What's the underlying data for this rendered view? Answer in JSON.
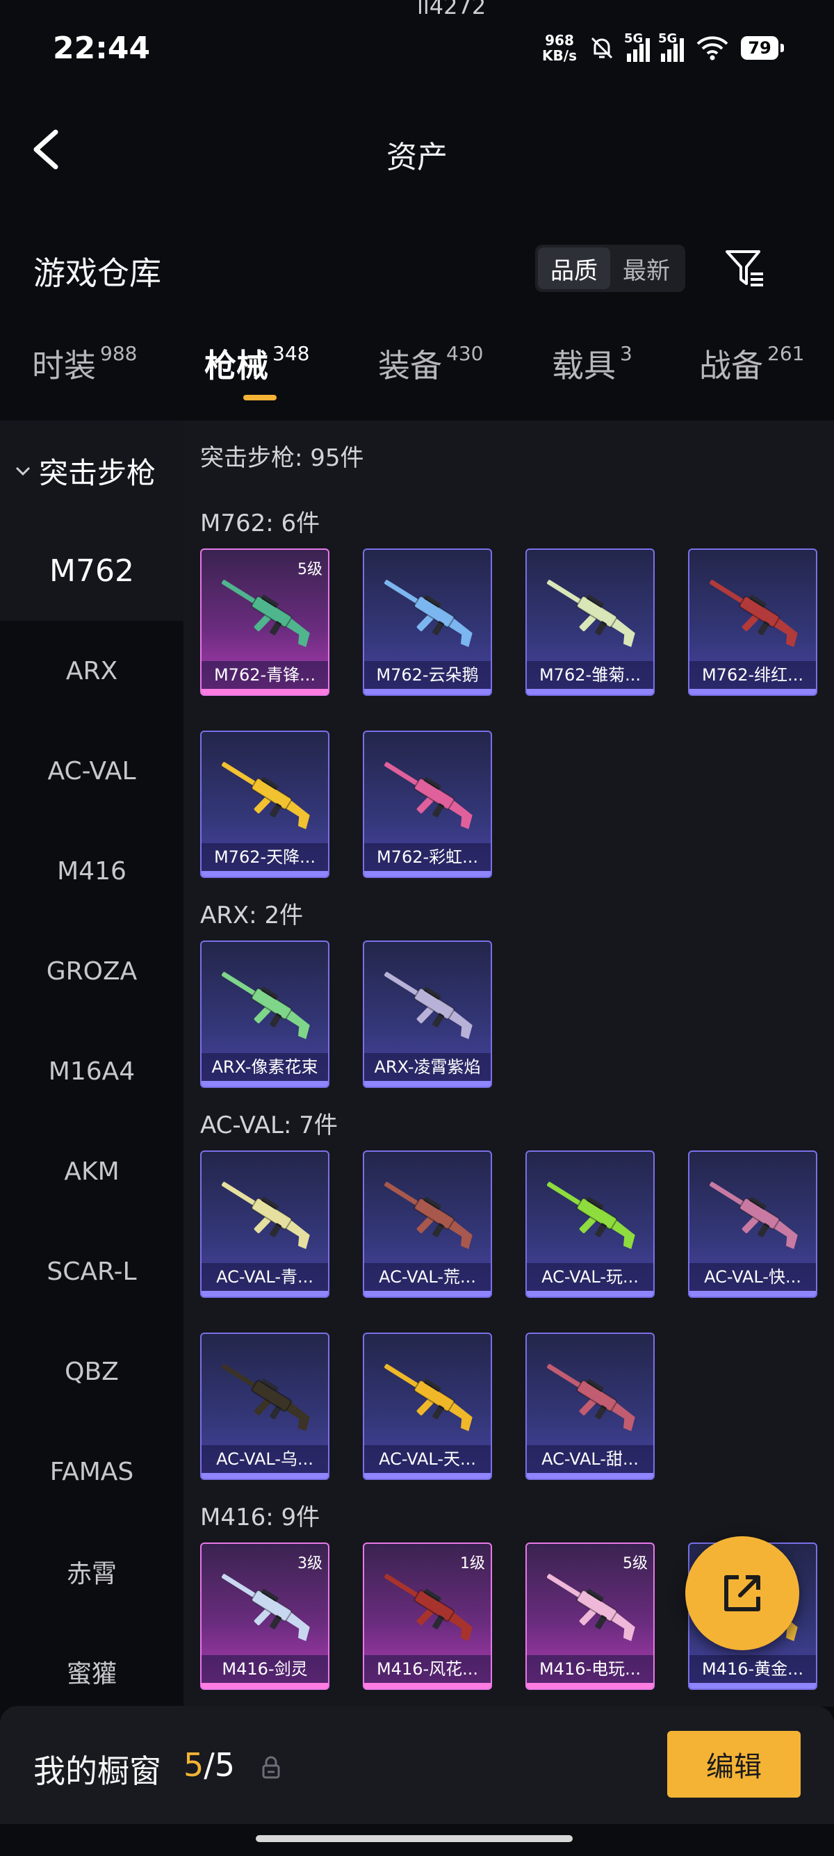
{
  "status_bar": {
    "time": "22:44",
    "notch_text": "ll4272",
    "net_speed_value": "968",
    "net_speed_unit": "KB/s",
    "sim1_label": "5G",
    "sim2_label": "5G",
    "battery": "79"
  },
  "header": {
    "title": "资产"
  },
  "warehouse": {
    "title": "游戏仓库",
    "sort_options": [
      {
        "label": "品质",
        "active": true
      },
      {
        "label": "最新",
        "active": false
      }
    ]
  },
  "tabs": [
    {
      "label": "时装",
      "count": "988",
      "active": false
    },
    {
      "label": "枪械",
      "count": "348",
      "active": true
    },
    {
      "label": "装备",
      "count": "430",
      "active": false
    },
    {
      "label": "载具",
      "count": "3",
      "active": false
    },
    {
      "label": "战备",
      "count": "261",
      "active": false
    }
  ],
  "sidebar": {
    "category": "突击步枪",
    "items": [
      "M762",
      "ARX",
      "AC-VAL",
      "M416",
      "GROZA",
      "M16A4",
      "AKM",
      "SCAR-L",
      "QBZ",
      "FAMAS",
      "赤霄",
      "蜜獾"
    ],
    "active_index": 0
  },
  "content": {
    "category_total": "突击步枪: 95件",
    "groups": [
      {
        "title": "M762: 6件",
        "items": [
          {
            "name": "M762-青锋...",
            "level": "5级",
            "rarity": "pink",
            "gun_color": "#4fb58d"
          },
          {
            "name": "M762-云朵鹅",
            "level": "",
            "rarity": "purple",
            "gun_color": "#7cb6f0"
          },
          {
            "name": "M762-雏菊...",
            "level": "",
            "rarity": "purple",
            "gun_color": "#d9e6b8"
          },
          {
            "name": "M762-绯红...",
            "level": "",
            "rarity": "purple",
            "gun_color": "#b23a3a"
          },
          {
            "name": "M762-天降...",
            "level": "",
            "rarity": "purple",
            "gun_color": "#f2c230"
          },
          {
            "name": "M762-彩虹...",
            "level": "",
            "rarity": "purple",
            "gun_color": "#e0609c"
          }
        ]
      },
      {
        "title": "ARX: 2件",
        "items": [
          {
            "name": "ARX-像素花束",
            "level": "",
            "rarity": "purple",
            "gun_color": "#7fd68a"
          },
          {
            "name": "ARX-凌霄紫焰",
            "level": "",
            "rarity": "purple",
            "gun_color": "#b9b2d8"
          }
        ]
      },
      {
        "title": "AC-VAL: 7件",
        "items": [
          {
            "name": "AC-VAL-青...",
            "level": "",
            "rarity": "purple",
            "gun_color": "#e6e0a0"
          },
          {
            "name": "AC-VAL-荒...",
            "level": "",
            "rarity": "purple",
            "gun_color": "#a8584c"
          },
          {
            "name": "AC-VAL-玩...",
            "level": "",
            "rarity": "purple",
            "gun_color": "#8edc3e"
          },
          {
            "name": "AC-VAL-快...",
            "level": "",
            "rarity": "purple",
            "gun_color": "#c97aa2"
          },
          {
            "name": "AC-VAL-乌...",
            "level": "",
            "rarity": "purple",
            "gun_color": "#3a3326"
          },
          {
            "name": "AC-VAL-天...",
            "level": "",
            "rarity": "purple",
            "gun_color": "#f0b829"
          },
          {
            "name": "AC-VAL-甜...",
            "level": "",
            "rarity": "purple",
            "gun_color": "#c25c70"
          }
        ]
      },
      {
        "title": "M416: 9件",
        "items": [
          {
            "name": "M416-剑灵",
            "level": "3级",
            "rarity": "pink",
            "gun_color": "#c8d8f0"
          },
          {
            "name": "M416-风花...",
            "level": "1级",
            "rarity": "pink",
            "gun_color": "#a8332c"
          },
          {
            "name": "M416-电玩...",
            "level": "5级",
            "rarity": "pink",
            "gun_color": "#f0b8d8"
          },
          {
            "name": "M416-黄金...",
            "level": "",
            "rarity": "purple",
            "gun_color": "#e6b23a"
          }
        ]
      }
    ]
  },
  "bottom_bar": {
    "label": "我的橱窗",
    "current": "5",
    "separator": "/",
    "total": "5",
    "edit_label": "编辑"
  },
  "colors": {
    "accent": "#f5b335",
    "background": "#0b0c10",
    "panel": "#16171d",
    "rare_purple": "#7a70e8",
    "rare_pink": "#e779e8"
  }
}
